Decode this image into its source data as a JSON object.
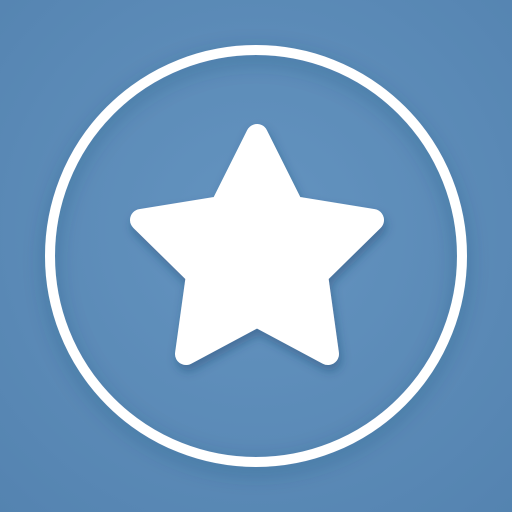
{
  "icon": {
    "name": "star-icon",
    "colors": {
      "background": "#6494C0",
      "background_edge": "#5483B0",
      "ring": "#FFFFFF",
      "star": "#FFFFFF"
    }
  }
}
